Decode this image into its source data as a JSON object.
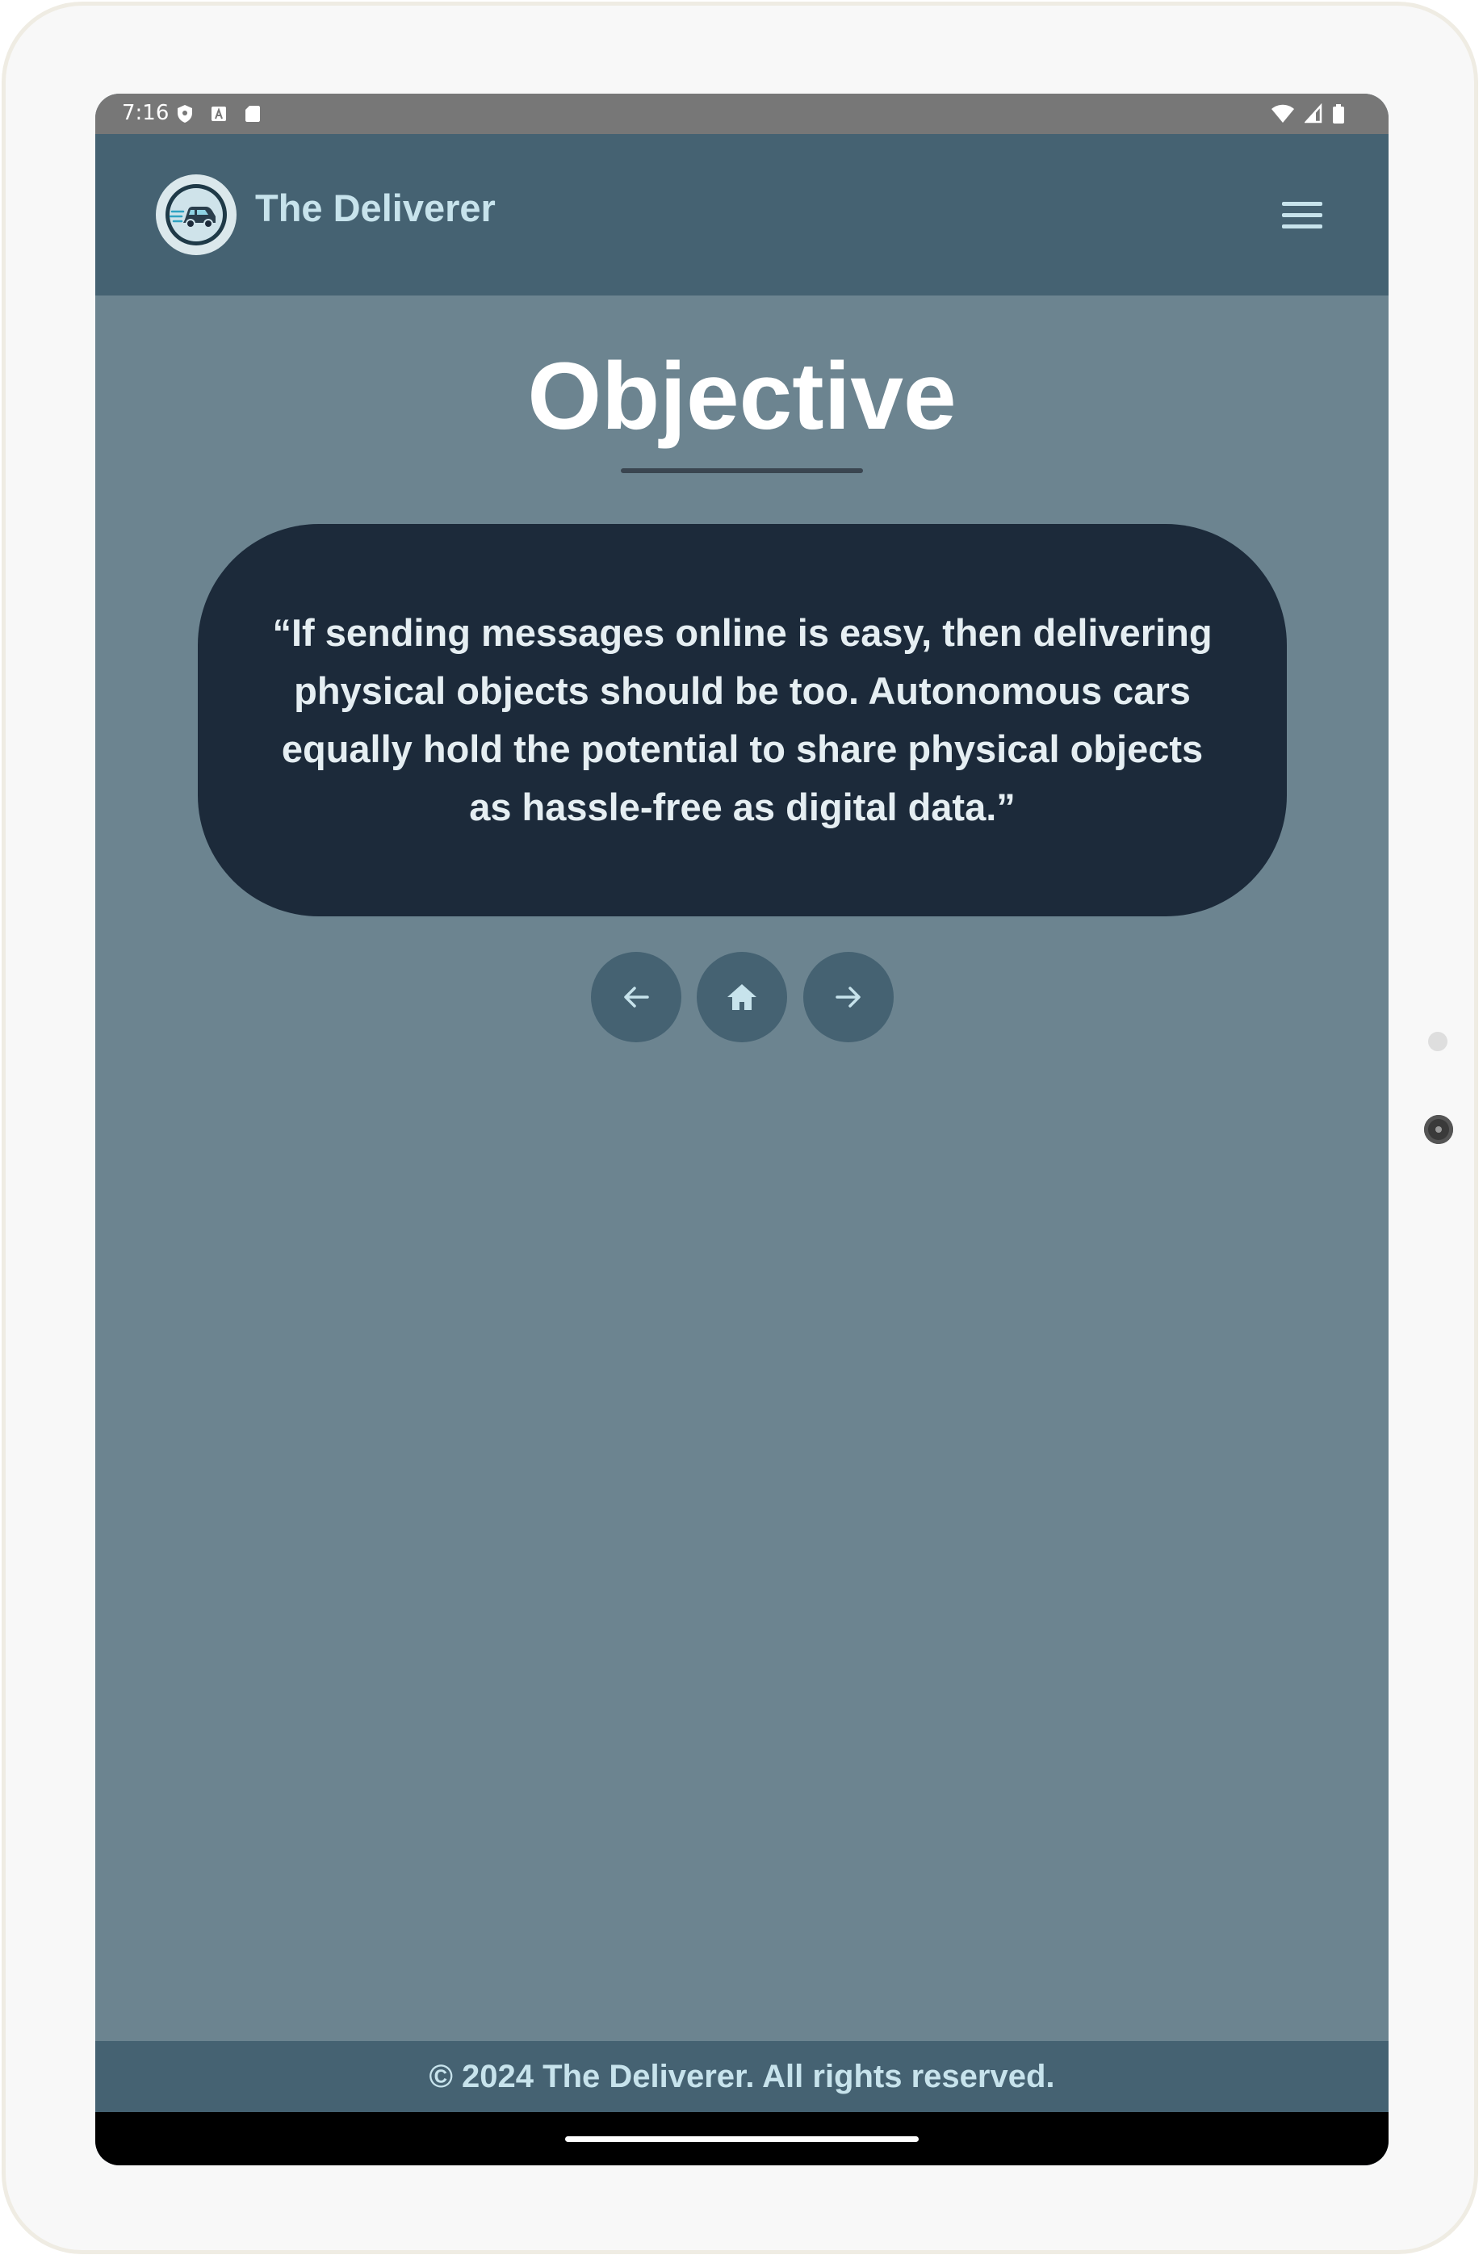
{
  "status_bar": {
    "time": "7:16",
    "left_icons": [
      "shield-icon",
      "a-badge-icon",
      "sd-card-icon"
    ],
    "right_icons": [
      "wifi-icon",
      "cell-signal-icon",
      "battery-icon"
    ]
  },
  "header": {
    "brand_name": "The Deliverer",
    "logo_icon": "delivery-car-logo-icon",
    "menu_icon": "hamburger-menu-icon"
  },
  "main": {
    "title": "Objective",
    "quote": "“If sending messages online is easy, then delivering physical objects should be too. Autonomous cars equally hold the potential to share physical objects as hassle-free as digital data.”"
  },
  "nav_buttons": {
    "prev_icon": "arrow-left-icon",
    "home_icon": "home-icon",
    "next_icon": "arrow-right-icon"
  },
  "footer": {
    "text": "© 2024 The Deliverer. All rights reserved."
  },
  "colors": {
    "page_bg": "#6c8490",
    "header_bg": "#456272",
    "quote_card_bg": "#1c2a3a",
    "brand_text": "#c7e3ec"
  }
}
